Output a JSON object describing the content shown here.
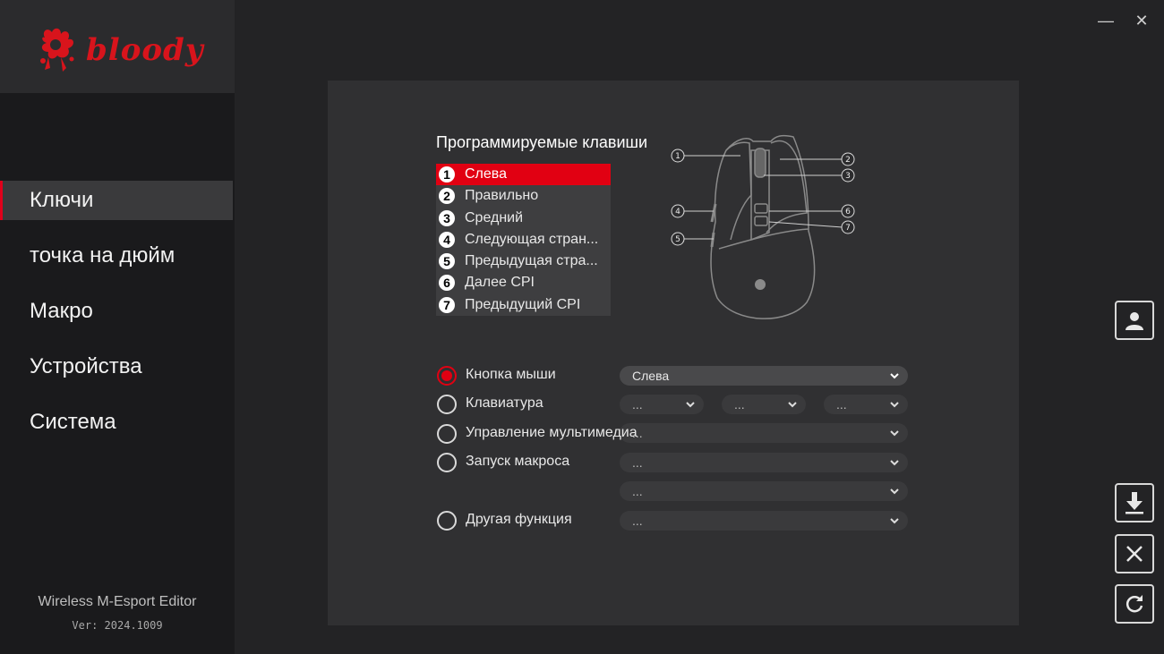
{
  "app": {
    "logo_text": "bloody",
    "editor_name": "Wireless M-Esport Editor",
    "version": "Ver: 2024.1009"
  },
  "window_controls": {
    "minimize": "—",
    "close": "✕"
  },
  "sidebar": {
    "items": [
      {
        "label": "Ключи",
        "active": true
      },
      {
        "label": "точка на дюйм",
        "active": false
      },
      {
        "label": "Макро",
        "active": false
      },
      {
        "label": "Устройства",
        "active": false
      },
      {
        "label": "Система",
        "active": false
      }
    ]
  },
  "keys": {
    "title": "Программируемые клавиши",
    "items": [
      {
        "num": "1",
        "label": "Слева",
        "selected": true
      },
      {
        "num": "2",
        "label": "Правильно",
        "selected": false
      },
      {
        "num": "3",
        "label": "Средний",
        "selected": false
      },
      {
        "num": "4",
        "label": "Следующая стран...",
        "selected": false
      },
      {
        "num": "5",
        "label": "Предыдущая стра...",
        "selected": false
      },
      {
        "num": "6",
        "label": "Далее CPI",
        "selected": false
      },
      {
        "num": "7",
        "label": "Предыдущий CPI",
        "selected": false
      }
    ]
  },
  "diagram": {
    "callouts": [
      "1",
      "2",
      "3",
      "4",
      "5",
      "6",
      "7"
    ]
  },
  "options": {
    "mouse_button": {
      "label": "Кнопка мыши",
      "checked": true,
      "value": "Слева"
    },
    "keyboard": {
      "label": "Клавиатура",
      "checked": false,
      "values": [
        "...",
        "...",
        "..."
      ]
    },
    "multimedia": {
      "label": "Управление мультимедиа",
      "checked": false,
      "value": "..."
    },
    "macro": {
      "label": "Запуск макроса",
      "checked": false,
      "value": "...",
      "value2": "..."
    },
    "other": {
      "label": "Другая функция",
      "checked": false,
      "value": "..."
    }
  },
  "side_buttons": [
    "user-icon",
    "download-icon",
    "close-icon",
    "refresh-icon"
  ],
  "colors": {
    "accent": "#e10012",
    "background": "#232325",
    "panel": "#303032",
    "sidebar": "#1a1a1c"
  }
}
